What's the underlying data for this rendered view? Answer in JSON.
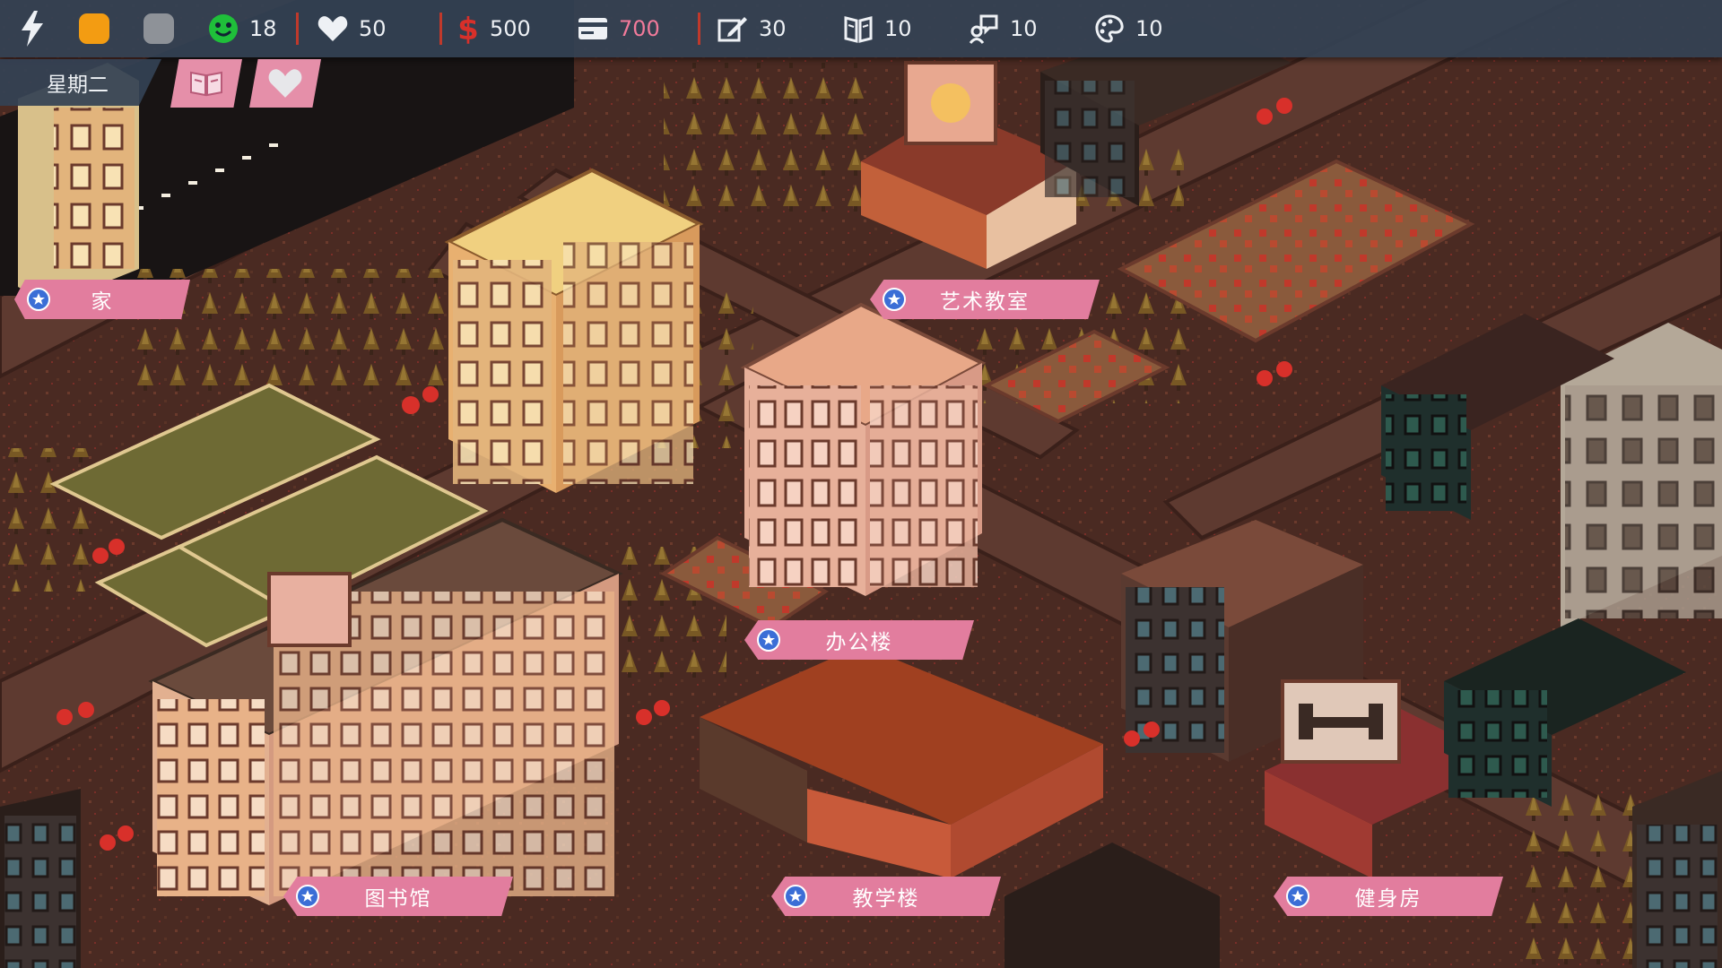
{
  "hud": {
    "energy_icon": "lightning-icon",
    "indicators": [
      {
        "name": "orange-status-dot",
        "color": "#f39c12"
      },
      {
        "name": "gray-status-dot",
        "color": "#8e9298"
      }
    ],
    "stats": [
      {
        "icon": "smiley-icon",
        "value": "18"
      },
      {
        "icon": "heart-icon",
        "value": "50"
      },
      {
        "icon": "dollar-icon",
        "value": "500"
      },
      {
        "icon": "card-icon",
        "value": "700"
      },
      {
        "icon": "pencil-icon",
        "value": "30"
      },
      {
        "icon": "book-stat-icon",
        "value": "10"
      },
      {
        "icon": "chat-stat-icon",
        "value": "10"
      },
      {
        "icon": "palette-stat-icon",
        "value": "10"
      }
    ]
  },
  "day": "星期二",
  "buttons": {
    "journal_icon": "book-icon",
    "relationship_icon": "heart-icon"
  },
  "locations": [
    {
      "id": "home",
      "label": "家"
    },
    {
      "id": "art-classroom",
      "label": "艺术教室"
    },
    {
      "id": "office",
      "label": "办公楼"
    },
    {
      "id": "library",
      "label": "图书馆"
    },
    {
      "id": "teaching",
      "label": "教学楼"
    },
    {
      "id": "gym",
      "label": "健身房"
    }
  ],
  "colors": {
    "hud_bg": "#344254",
    "label_bg": "#e27d9e",
    "accent_red": "#c0392b",
    "pink_value": "#f27a9a"
  }
}
